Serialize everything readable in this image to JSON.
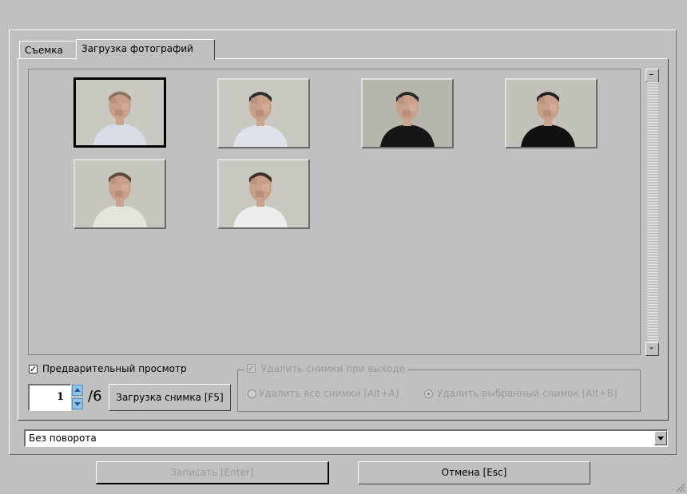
{
  "tabs": [
    {
      "label": "Съемка",
      "active": false
    },
    {
      "label": "Загрузка фотографий",
      "active": true
    }
  ],
  "thumbnails": [
    {
      "name": "photo-1",
      "selected": true,
      "bg": "#c9c9c1",
      "shirt": "#d8dde8",
      "hair": "#8a7460",
      "pose": "front"
    },
    {
      "name": "photo-2",
      "selected": false,
      "bg": "#c8c8c0",
      "shirt": "#dfe2ea",
      "hair": "#2e2e2e",
      "pose": "side"
    },
    {
      "name": "photo-3",
      "selected": false,
      "bg": "#b6b6ab",
      "shirt": "#161616",
      "hair": "#2a2a2a",
      "pose": "front"
    },
    {
      "name": "photo-4",
      "selected": false,
      "bg": "#c2c2ba",
      "shirt": "#111111",
      "hair": "#222222",
      "pose": "side"
    },
    {
      "name": "photo-5",
      "selected": false,
      "bg": "#c6c6bd",
      "shirt": "#e4e4dc",
      "hair": "#5a4a3c",
      "pose": "front"
    },
    {
      "name": "photo-6",
      "selected": false,
      "bg": "#c8c8bf",
      "shirt": "#ececea",
      "hair": "#3c3026",
      "pose": "side"
    }
  ],
  "preview": {
    "label": "Предварительный просмотр",
    "checked": true
  },
  "counter": {
    "current": "1",
    "total": "/6"
  },
  "load_button": {
    "label": "Загрузка снимка [F5]"
  },
  "delete_group": {
    "title": "Удалить снимки при выходе",
    "checked": true,
    "option_all": "Удалить все снимки [Alt+A]",
    "option_selected": "Удалить выбранный снимок [Alt+B]",
    "selected_option": "selected"
  },
  "rotation": {
    "value": "Без поворота"
  },
  "footer": {
    "save": "Записать [Enter]",
    "cancel": "Отмена [Esc]"
  }
}
